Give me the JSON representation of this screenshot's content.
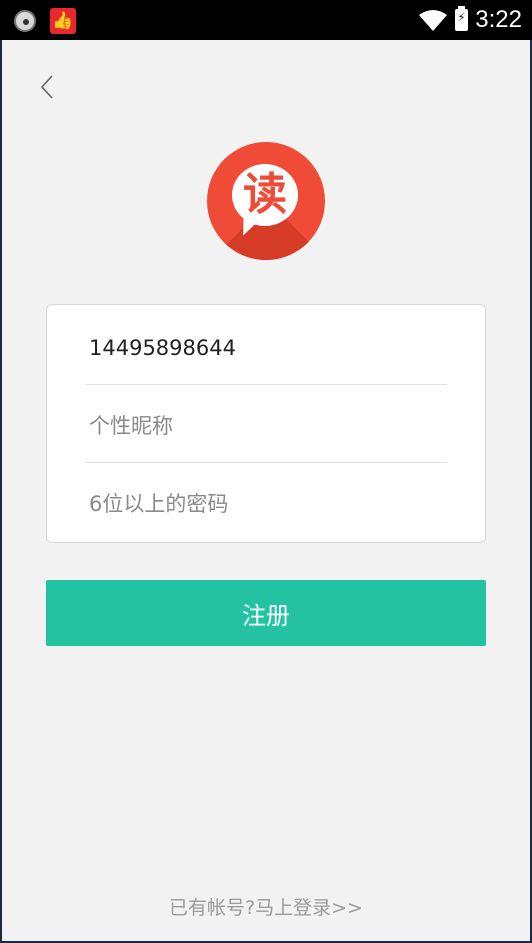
{
  "status_bar": {
    "time": "3:22",
    "left_icons": [
      "ball-icon",
      "thumbs-up-icon"
    ],
    "right_icons": [
      "wifi-icon",
      "battery-charging-icon"
    ]
  },
  "logo": {
    "char": "读",
    "color": "#ef4b36"
  },
  "form": {
    "phone_value": "14495898644",
    "nickname_placeholder": "个性昵称",
    "password_placeholder": "6位以上的密码"
  },
  "register_button": {
    "label": "注册",
    "color": "#23c3a1"
  },
  "login_link": {
    "label": "已有帐号?马上登录>>"
  }
}
